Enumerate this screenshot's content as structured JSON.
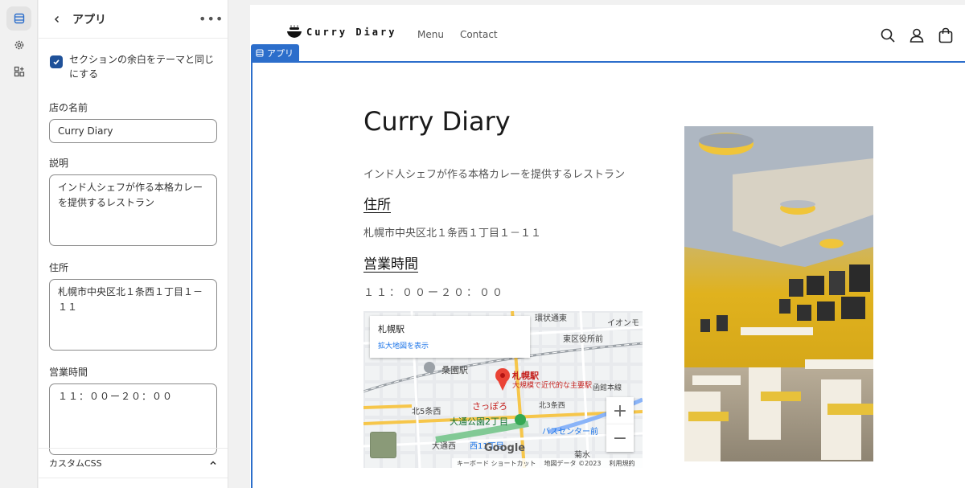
{
  "panel": {
    "title": "アプリ",
    "more": "•••",
    "checkbox_label": "セクションの余白をテーマと同じにする",
    "fields": {
      "name_label": "店の名前",
      "name_value": "Curry Diary",
      "desc_label": "説明",
      "desc_value": "インド人シェフが作る本格カレーを提供するレストラン",
      "address_label": "住所",
      "address_value": "札幌市中央区北１条西１丁目１－１１",
      "hours_label": "営業時間",
      "hours_value": "１１：００ー２０：００"
    },
    "custom_css_label": "カスタムCSS"
  },
  "preview": {
    "logo_text": "Curry Diary",
    "nav": [
      "Menu",
      "Contact"
    ],
    "section_tag": "アプリ",
    "shop_title": "Curry Diary",
    "shop_desc": "インド人シェフが作る本格カレーを提供するレストラン",
    "address_heading": "住所",
    "address": "札幌市中央区北１条西１丁目１－１１",
    "hours_heading": "営業時間",
    "hours": "１１：００ー２０：００",
    "map": {
      "place_name": "札幌駅",
      "link": "拡大地図を表示",
      "marker_label": "札幌駅",
      "marker_sub": "大規模で近代的な主要駅",
      "labels": [
        "桑園駅",
        "さっぽろ",
        "大通公園2丁目",
        "北5条西",
        "北3条西",
        "東区役所前",
        "環状通東",
        "イオンモ",
        "函館本線",
        "バスセンター前",
        "大通西",
        "西11丁目",
        "菊水"
      ],
      "google": "Google",
      "footer": [
        "キーボード ショートカット",
        "地図データ ©2023",
        "利用規約"
      ]
    }
  }
}
